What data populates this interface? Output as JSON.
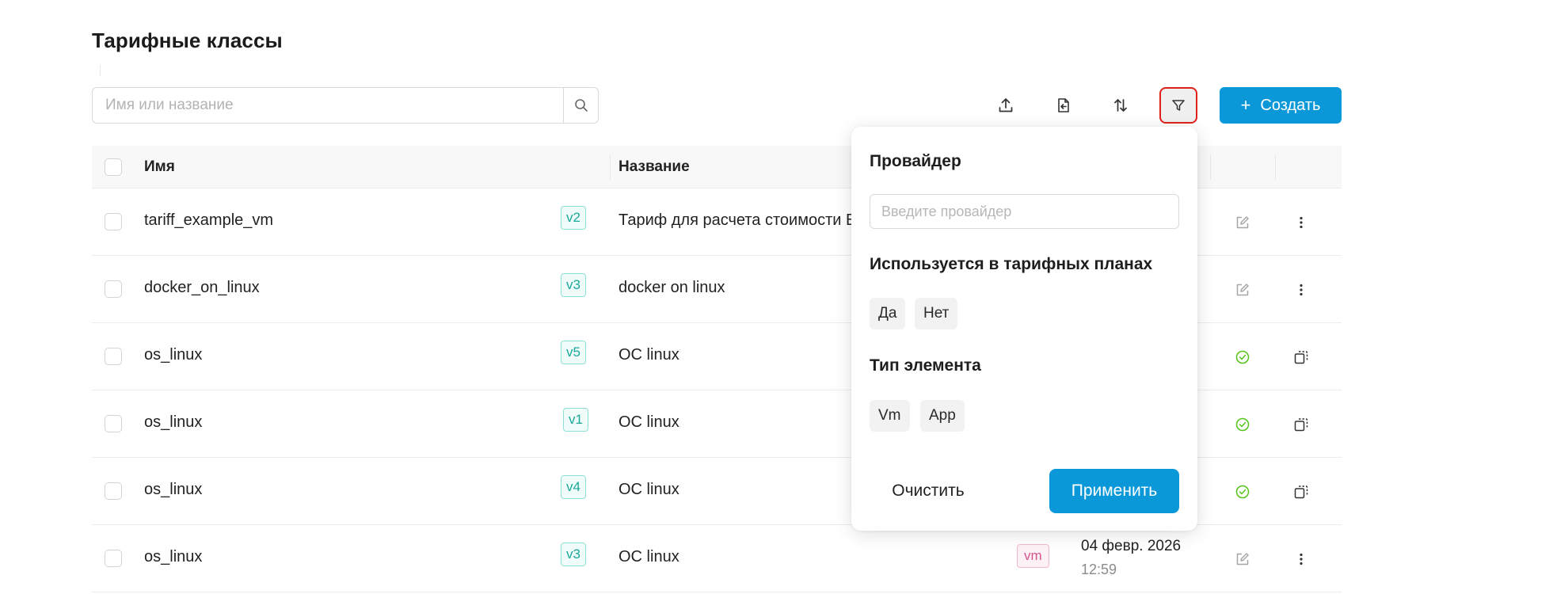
{
  "page": {
    "title": "Тарифные классы"
  },
  "search": {
    "placeholder": "Имя или название"
  },
  "toolbar": {
    "create_label": "Создать",
    "create_icon": "plus",
    "icons": [
      "upload-icon",
      "import-file-icon",
      "sort-icon",
      "filter-icon"
    ]
  },
  "table": {
    "headers": {
      "name": "Имя",
      "title": "Название"
    },
    "rows": [
      {
        "name": "tariff_example_vm",
        "version": "v2",
        "title": "Тариф для расчета стоимости ВМ",
        "status_icon": "edit-icon",
        "action_icon": "more-icon"
      },
      {
        "name": "docker_on_linux",
        "version": "v3",
        "title": "docker on linux",
        "status_icon": "edit-icon",
        "action_icon": "more-icon"
      },
      {
        "name": "os_linux",
        "version": "v5",
        "title": "ОС linux",
        "status_icon": "check-circle-icon",
        "action_icon": "copy-icon"
      },
      {
        "name": "os_linux",
        "version": "v1",
        "title": "ОС linux",
        "status_icon": "check-circle-icon",
        "action_icon": "copy-icon"
      },
      {
        "name": "os_linux",
        "version": "v4",
        "title": "ОС linux",
        "status_icon": "check-circle-icon",
        "action_icon": "copy-icon"
      },
      {
        "name": "os_linux",
        "version": "v3",
        "title": "ОС linux",
        "type_badge": "vm",
        "date": "04 февр. 2026",
        "time": "12:59",
        "status_icon": "edit-icon",
        "action_icon": "more-icon"
      }
    ]
  },
  "filter_popover": {
    "provider_heading": "Провайдер",
    "provider_placeholder": "Введите провайдер",
    "used_heading": "Используется в тарифных планах",
    "used_options": [
      "Да",
      "Нет"
    ],
    "type_heading": "Тип элемента",
    "type_options": [
      "Vm",
      "App"
    ],
    "clear_label": "Очистить",
    "apply_label": "Применить"
  },
  "colors": {
    "accent": "#0a98d8",
    "highlight_border": "#e0221b",
    "version_badge": "#1aa89a",
    "vm_badge": "#d6548c",
    "success": "#52c41a"
  }
}
